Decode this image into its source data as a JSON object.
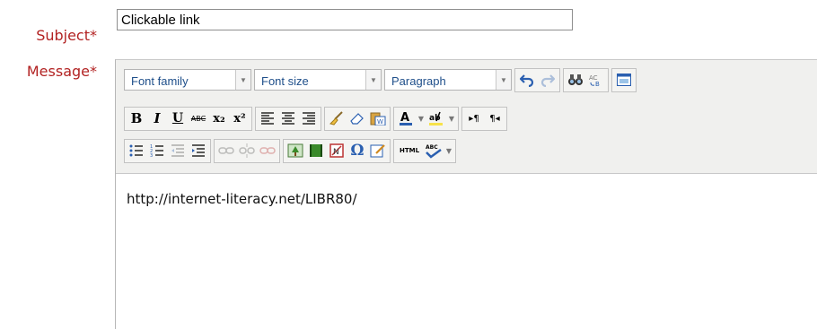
{
  "form": {
    "subject_label": "Subject",
    "message_label": "Message",
    "required_mark": "*",
    "subject_value": "Clickable link"
  },
  "toolbar": {
    "font_family": "Font family",
    "font_size": "Font size",
    "format": "Paragraph",
    "bold": "B",
    "italic": "I",
    "underline": "U",
    "strikethrough": "ABC",
    "subscript": "x₂",
    "superscript": "x²",
    "ltr": "▸¶",
    "rtl": "¶◂",
    "omega": "Ω",
    "html": "HTML",
    "spell": "ABC"
  },
  "editor": {
    "content": "http://internet-literacy.net/LIBR80/"
  },
  "colors": {
    "label": "#b22222",
    "toolbar_bg": "#f0f0ee",
    "select_text": "#1f4f8a"
  }
}
